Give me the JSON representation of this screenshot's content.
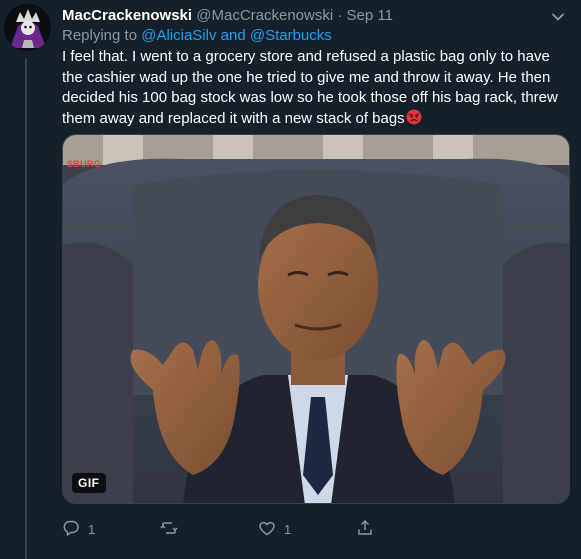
{
  "tweet": {
    "display_name": "MacCrackenowski",
    "handle": "@MacCrackenowski",
    "separator": "·",
    "date": "Sep 11",
    "replying_prefix": "Replying to",
    "mention_1": "@AliciaSilv",
    "mention_joiner": "and",
    "mention_2": "@Starbucks",
    "text": "I feel that. I went to a grocery store and refused a plastic bag only to have the cashier wad up the one he tried to give me and throw it away. He then decided his 100 bag stock was low so he took those off his bag rack, threw them away and replaced it with a new stack of bags",
    "emoji": "angry-face"
  },
  "media": {
    "badge": "GIF",
    "watermark": "SBURG"
  },
  "actions": {
    "reply_count": "1",
    "retweet_count": "",
    "like_count": "1"
  },
  "colors": {
    "background": "#15202b",
    "secondary_text": "#8899a6",
    "link": "#1da1f2",
    "divider": "#38444d"
  }
}
